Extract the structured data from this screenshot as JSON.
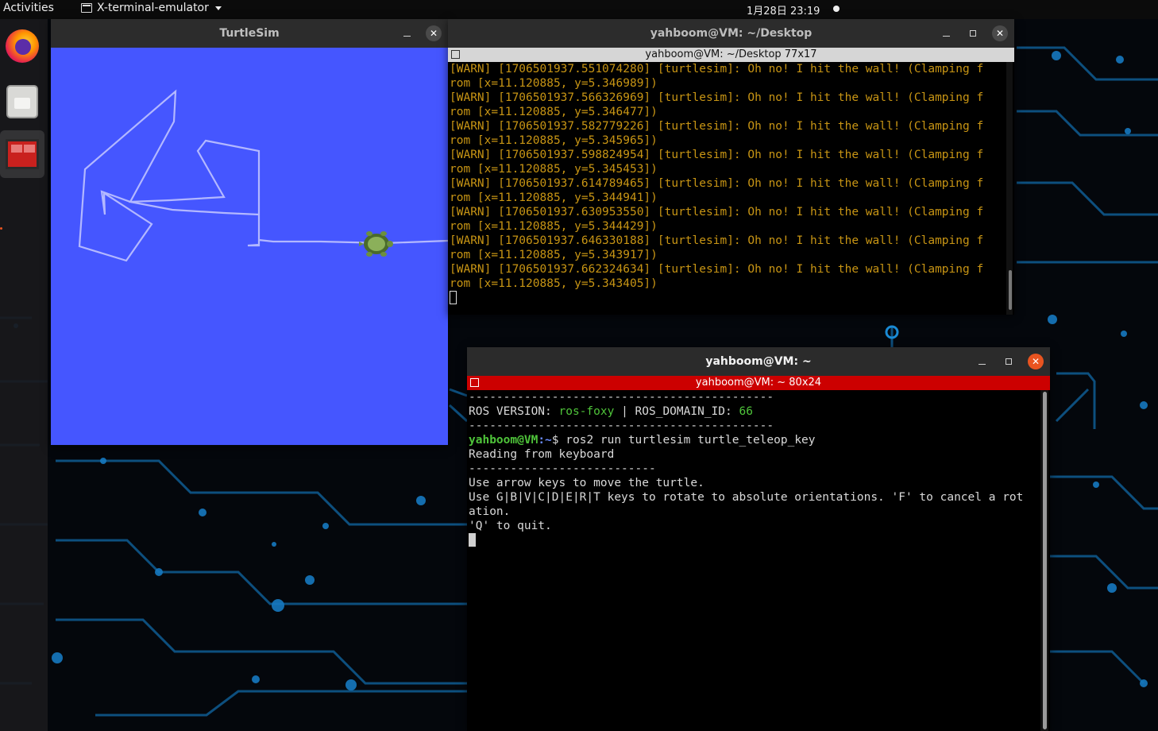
{
  "topbar": {
    "activities": "Activities",
    "app_menu": "X-terminal-emulator",
    "clock": "1月28日  23:19"
  },
  "dock": {
    "items": [
      "firefox-icon",
      "files-icon",
      "terminal-icon"
    ]
  },
  "turtlesim": {
    "title": "TurtleSim",
    "background_color": "#4556ff",
    "pen_color": "#b3b8ff"
  },
  "terminal_desktop": {
    "title": "yahboom@VM: ~/Desktop",
    "subtitle": "yahboom@VM: ~/Desktop 77x17",
    "lines": [
      "[WARN] [1706501937.551074280] [turtlesim]: Oh no! I hit the wall! (Clamping f",
      "rom [x=11.120885, y=5.346989])",
      "[WARN] [1706501937.566326969] [turtlesim]: Oh no! I hit the wall! (Clamping f",
      "rom [x=11.120885, y=5.346477])",
      "[WARN] [1706501937.582779226] [turtlesim]: Oh no! I hit the wall! (Clamping f",
      "rom [x=11.120885, y=5.345965])",
      "[WARN] [1706501937.598824954] [turtlesim]: Oh no! I hit the wall! (Clamping f",
      "rom [x=11.120885, y=5.345453])",
      "[WARN] [1706501937.614789465] [turtlesim]: Oh no! I hit the wall! (Clamping f",
      "rom [x=11.120885, y=5.344941])",
      "[WARN] [1706501937.630953550] [turtlesim]: Oh no! I hit the wall! (Clamping f",
      "rom [x=11.120885, y=5.344429])",
      "[WARN] [1706501937.646330188] [turtlesim]: Oh no! I hit the wall! (Clamping f",
      "rom [x=11.120885, y=5.343917])",
      "[WARN] [1706501937.662324634] [turtlesim]: Oh no! I hit the wall! (Clamping f",
      "rom [x=11.120885, y=5.343405])"
    ]
  },
  "terminal_home": {
    "title": "yahboom@VM: ~",
    "subtitle": "yahboom@VM: ~ 80x24",
    "separator": "--------------------------------------------",
    "ros_version_label": "ROS VERSION: ",
    "ros_version_value": "ros-foxy",
    "domain_label": " | ROS_DOMAIN_ID: ",
    "domain_value": "66",
    "prompt_user": "yahboom@VM",
    "prompt_path": ":~",
    "prompt_symbol": "$ ",
    "command": "ros2 run turtlesim turtle_teleop_key",
    "output": [
      "Reading from keyboard",
      "---------------------------",
      "Use arrow keys to move the turtle.",
      "Use G|B|V|C|D|E|R|T keys to rotate to absolute orientations. 'F' to cancel a rot",
      "ation.",
      "'Q' to quit."
    ]
  },
  "colors": {
    "warn": "#c89514",
    "prompt_green": "#4fc43a",
    "title_red": "#cc0000",
    "ubuntu_orange": "#e95420"
  }
}
